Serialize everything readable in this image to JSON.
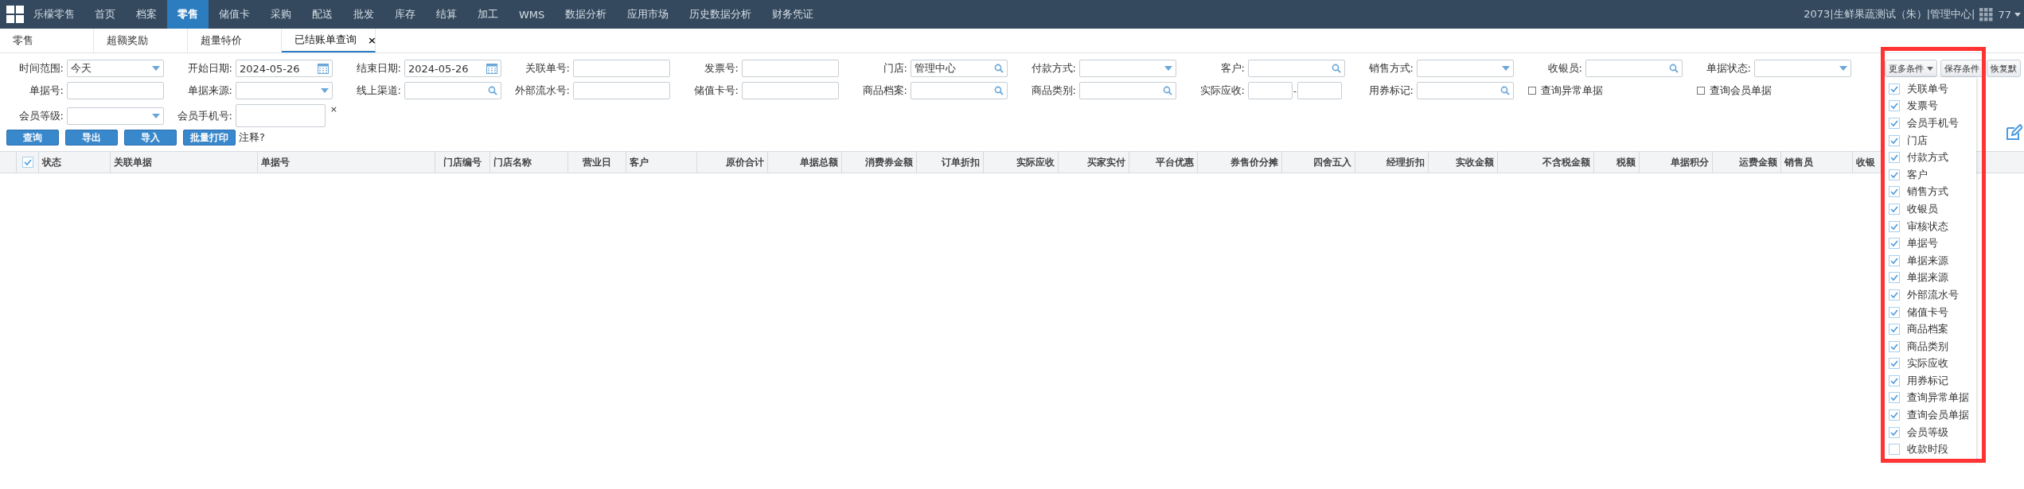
{
  "nav": {
    "brand": "乐檬零售",
    "items": [
      {
        "label": "首页",
        "selected": false
      },
      {
        "label": "档案",
        "selected": false
      },
      {
        "label": "零售",
        "selected": true
      },
      {
        "label": "储值卡",
        "selected": false
      },
      {
        "label": "采购",
        "selected": false
      },
      {
        "label": "配送",
        "selected": false
      },
      {
        "label": "批发",
        "selected": false
      },
      {
        "label": "库存",
        "selected": false
      },
      {
        "label": "结算",
        "selected": false
      },
      {
        "label": "加工",
        "selected": false
      },
      {
        "label": "WMS",
        "selected": false
      },
      {
        "label": "数据分析",
        "selected": false
      },
      {
        "label": "应用市场",
        "selected": false
      },
      {
        "label": "历史数据分析",
        "selected": false
      },
      {
        "label": "财务凭证",
        "selected": false
      }
    ],
    "account": "2073|生鲜果蔬测试（朱）|管理中心|",
    "user": "77"
  },
  "tabs": [
    {
      "label": "零售",
      "selected": false
    },
    {
      "label": "超额奖励",
      "selected": false
    },
    {
      "label": "超量特价",
      "selected": false
    },
    {
      "label": "已结账单查询",
      "selected": true,
      "close": "×"
    }
  ],
  "filters": {
    "rows": [
      [
        {
          "kind": "select",
          "label": "时间范围:",
          "value": "今天"
        },
        {
          "kind": "date",
          "label": "开始日期:",
          "value": "2024-05-26"
        },
        {
          "kind": "date",
          "label": "结束日期:",
          "value": "2024-05-26"
        },
        {
          "kind": "text",
          "label": "关联单号:"
        },
        {
          "kind": "text",
          "label": "发票号:"
        },
        {
          "kind": "search",
          "label": "门店:",
          "value": "管理中心"
        },
        {
          "kind": "select",
          "label": "付款方式:"
        },
        {
          "kind": "search",
          "label": "客户:"
        },
        {
          "kind": "select",
          "label": "销售方式:"
        },
        {
          "kind": "search",
          "label": "收银员:"
        },
        {
          "kind": "select",
          "label": "单据状态:"
        }
      ],
      [
        {
          "kind": "text",
          "label": "单据号:"
        },
        {
          "kind": "select",
          "label": "单据来源:"
        },
        {
          "kind": "search",
          "label": "线上渠道:"
        },
        {
          "kind": "text",
          "label": "外部流水号:"
        },
        {
          "kind": "text",
          "label": "储值卡号:"
        },
        {
          "kind": "search",
          "label": "商品档案:"
        },
        {
          "kind": "search",
          "label": "商品类别:"
        },
        {
          "kind": "range",
          "label": "实际应收:",
          "separator": "-"
        },
        {
          "kind": "search",
          "label": "用券标记:"
        },
        {
          "kind": "checkbox",
          "label": "查询异常单据",
          "checked": false
        },
        {
          "kind": "checkbox",
          "label": "查询会员单据",
          "checked": false
        }
      ],
      [
        {
          "kind": "select",
          "label": "会员等级:"
        },
        {
          "kind": "text",
          "label": "会员手机号:",
          "clear": "×"
        }
      ]
    ],
    "tools": [
      "更多条件",
      "保存条件",
      "恢复默"
    ]
  },
  "more_conditions": [
    {
      "label": "关联单号",
      "checked": true
    },
    {
      "label": "发票号",
      "checked": true
    },
    {
      "label": "会员手机号",
      "checked": true
    },
    {
      "label": "门店",
      "checked": true
    },
    {
      "label": "付款方式",
      "checked": true
    },
    {
      "label": "客户",
      "checked": true
    },
    {
      "label": "销售方式",
      "checked": true
    },
    {
      "label": "收银员",
      "checked": true
    },
    {
      "label": "审核状态",
      "checked": true
    },
    {
      "label": "单据号",
      "checked": true
    },
    {
      "label": "单据来源",
      "checked": true
    },
    {
      "label": "单据来源",
      "checked": true
    },
    {
      "label": "外部流水号",
      "checked": true
    },
    {
      "label": "储值卡号",
      "checked": true
    },
    {
      "label": "商品档案",
      "checked": true
    },
    {
      "label": "商品类别",
      "checked": true
    },
    {
      "label": "实际应收",
      "checked": true
    },
    {
      "label": "用券标记",
      "checked": true
    },
    {
      "label": "查询异常单据",
      "checked": true
    },
    {
      "label": "查询会员单据",
      "checked": true
    },
    {
      "label": "会员等级",
      "checked": true
    },
    {
      "label": "收款时段",
      "checked": false
    }
  ],
  "actions": {
    "buttons": [
      "查询",
      "导出",
      "导入",
      "批量打印"
    ],
    "note": "注释?"
  },
  "table": {
    "select_all_checked": true,
    "columns": [
      "状态",
      "关联单据",
      "单据号",
      "门店编号",
      "门店名称",
      "营业日",
      "客户",
      "原价合计",
      "单据总额",
      "消费券金额",
      "订单折扣",
      "实际应收",
      "买家实付",
      "平台优惠",
      "券售价分摊",
      "四舍五入",
      "经理折扣",
      "实收金额",
      "不含税金额",
      "税额",
      "单据积分",
      "运费金额",
      "销售员",
      "收银"
    ]
  }
}
